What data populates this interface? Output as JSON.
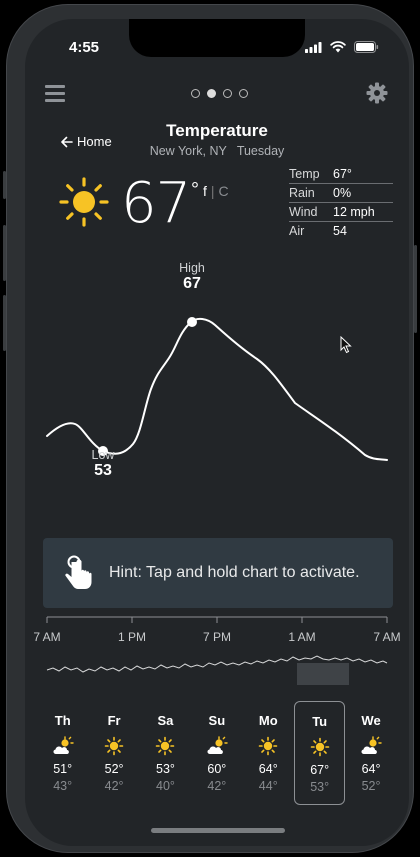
{
  "status": {
    "time": "4:55"
  },
  "header": {
    "title": "Temperature",
    "location": "New York, NY",
    "day": "Tuesday",
    "home_label": "Home"
  },
  "pager": {
    "count": 4,
    "active_index": 1
  },
  "current": {
    "temp": "67",
    "unit_f": "f",
    "unit_c": "C",
    "sep": "|",
    "deg": "°",
    "icon": "sun-icon"
  },
  "stats": [
    {
      "k": "Temp",
      "v": "67°"
    },
    {
      "k": "Rain",
      "v": "0%"
    },
    {
      "k": "Wind",
      "v": "12 mph"
    },
    {
      "k": "Air",
      "v": "54"
    }
  ],
  "chart": {
    "high_label": "High",
    "high_value": "67",
    "low_label": "Low",
    "low_value": "53",
    "line_color": "#ffffff"
  },
  "hint": {
    "text": "Hint: Tap and hold chart to activate."
  },
  "timeline": {
    "labels": [
      "7 AM",
      "1 PM",
      "7 PM",
      "1 AM",
      "7 AM"
    ]
  },
  "forecast": [
    {
      "day": "Th",
      "icon": "partly-cloudy-icon",
      "hi": "51°",
      "lo": "43°"
    },
    {
      "day": "Fr",
      "icon": "sun-icon",
      "hi": "52°",
      "lo": "42°"
    },
    {
      "day": "Sa",
      "icon": "sun-icon",
      "hi": "53°",
      "lo": "40°"
    },
    {
      "day": "Su",
      "icon": "partly-cloudy-icon",
      "hi": "60°",
      "lo": "42°"
    },
    {
      "day": "Mo",
      "icon": "sun-icon",
      "hi": "64°",
      "lo": "44°"
    },
    {
      "day": "Tu",
      "icon": "sun-icon",
      "hi": "67°",
      "lo": "53°",
      "selected": true
    },
    {
      "day": "We",
      "icon": "partly-cloudy-icon",
      "hi": "64°",
      "lo": "52°"
    }
  ],
  "colors": {
    "sun": "#f7c325",
    "background": "#222528",
    "hint_bg": "#303a42"
  }
}
